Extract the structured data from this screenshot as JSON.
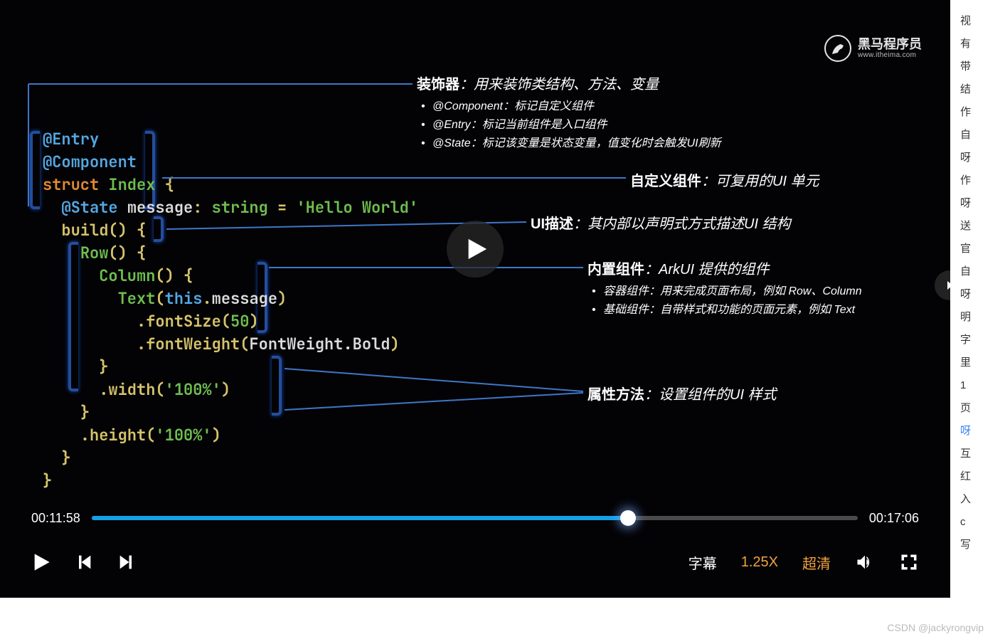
{
  "logo": {
    "cn": "黑马程序员",
    "en": "www.itheima.com"
  },
  "code": {
    "entry": "@Entry",
    "component": "@Component",
    "struct": "struct",
    "index": "Index",
    "lbrace": "{",
    "rbrace": "}",
    "state": "@State",
    "msg_id": "message",
    "colon_ty": ": ",
    "string_ty": "string",
    "eq": " = ",
    "hello": "'Hello World'",
    "build": "build",
    "parens": "()",
    "row": "Row",
    "column": "Column",
    "text": "Text",
    "this": "this",
    "dot": ".",
    "message_prop": "message",
    "fontSize": "fontSize",
    "fifty": "50",
    "fontWeight": "fontWeight",
    "fontWeightArg": "FontWeight.Bold",
    "width": "width",
    "height": "height",
    "hundred": "'100%'"
  },
  "annotations": {
    "decorator": {
      "title": "装饰器",
      "desc": "：用来装饰类结构、方法、变量",
      "items": [
        "@Component：标记自定义组件",
        "@Entry：标记当前组件是入口组件",
        "@State：标记该变量是状态变量，值变化时会触发UI刷新"
      ]
    },
    "custom": {
      "title": "自定义组件",
      "desc": "：可复用的UI 单元"
    },
    "uidesc": {
      "title": "UI描述",
      "desc": "：其内部以声明式方式描述UI 结构"
    },
    "builtin": {
      "title": "内置组件",
      "desc": "：ArkUI 提供的组件",
      "items": [
        "容器组件：用来完成页面布局，例如 Row、Column",
        "基础组件：自带样式和功能的页面元素，例如 Text"
      ]
    },
    "attr": {
      "title": "属性方法",
      "desc": "：设置组件的UI 样式"
    }
  },
  "player": {
    "current": "00:11:58",
    "total": "00:17:06",
    "progress_pct": 70,
    "subtitle": "字幕",
    "speed": "1.25X",
    "quality": "超清"
  },
  "side_text": [
    "视",
    "有",
    "带",
    "结",
    "作",
    "自",
    "呀",
    "作",
    "呀",
    "送",
    "官",
    "自",
    "呀",
    "明",
    "字",
    "里",
    "1",
    "页",
    "呀",
    "互",
    "红",
    "入",
    "c",
    "写"
  ],
  "side_blue_index": 18,
  "watermark": "CSDN @jackyrongvip"
}
